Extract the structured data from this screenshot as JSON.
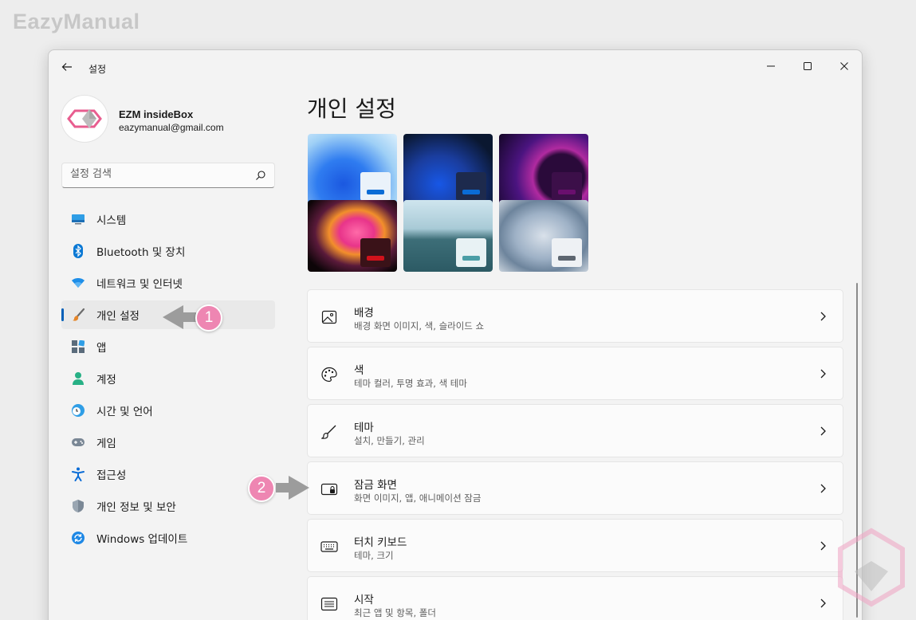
{
  "site_logo": "EazyManual",
  "window": {
    "title": "설정",
    "controls": {
      "minimize": "minimize",
      "maximize": "maximize",
      "close": "close"
    }
  },
  "profile": {
    "name": "EZM insideBox",
    "email": "eazymanual@gmail.com"
  },
  "search": {
    "placeholder": "설정 검색",
    "value": ""
  },
  "nav": {
    "items": [
      {
        "label": "시스템",
        "icon": "monitor-icon",
        "selected": false
      },
      {
        "label": "Bluetooth 및 장치",
        "icon": "bluetooth-icon",
        "selected": false
      },
      {
        "label": "네트워크 및 인터넷",
        "icon": "wifi-icon",
        "selected": false
      },
      {
        "label": "개인 설정",
        "icon": "brush-icon",
        "selected": true
      },
      {
        "label": "앱",
        "icon": "apps-icon",
        "selected": false
      },
      {
        "label": "계정",
        "icon": "account-icon",
        "selected": false
      },
      {
        "label": "시간 및 언어",
        "icon": "globe-clock-icon",
        "selected": false
      },
      {
        "label": "게임",
        "icon": "gamepad-icon",
        "selected": false
      },
      {
        "label": "접근성",
        "icon": "accessibility-icon",
        "selected": false
      },
      {
        "label": "개인 정보 및 보안",
        "icon": "shield-icon",
        "selected": false
      },
      {
        "label": "Windows 업데이트",
        "icon": "update-icon",
        "selected": false
      }
    ]
  },
  "main": {
    "title": "개인 설정",
    "themes": [
      {
        "name": "windows-light",
        "accent": "#0a6cd6"
      },
      {
        "name": "windows-dark",
        "accent": "#0a6cd6"
      },
      {
        "name": "glow",
        "accent": "#6a0f6e"
      },
      {
        "name": "captured-motion",
        "accent": "#d0121b"
      },
      {
        "name": "sunrise",
        "accent": "#4a9ea6"
      },
      {
        "name": "flow",
        "accent": "#5d6670"
      }
    ],
    "settings": [
      {
        "title": "배경",
        "subtitle": "배경 화면 이미지, 색, 슬라이드 쇼",
        "icon": "image-icon"
      },
      {
        "title": "색",
        "subtitle": "테마 컬러, 투명 효과, 색 테마",
        "icon": "palette-icon"
      },
      {
        "title": "테마",
        "subtitle": "설치, 만들기, 관리",
        "icon": "brush-icon"
      },
      {
        "title": "잠금 화면",
        "subtitle": "화면 이미지, 앱, 애니메이션 잠금",
        "icon": "lock-screen-icon"
      },
      {
        "title": "터치 키보드",
        "subtitle": "테마, 크기",
        "icon": "keyboard-icon"
      },
      {
        "title": "시작",
        "subtitle": "최근 앱 및 항목, 폴더",
        "icon": "start-icon"
      }
    ]
  },
  "annotations": {
    "marker_1": "1",
    "marker_2": "2",
    "color": "#ee86b2"
  },
  "colors": {
    "accent": "#005fb8",
    "window_bg": "#f3f3f3",
    "card_bg": "#fbfbfb"
  }
}
